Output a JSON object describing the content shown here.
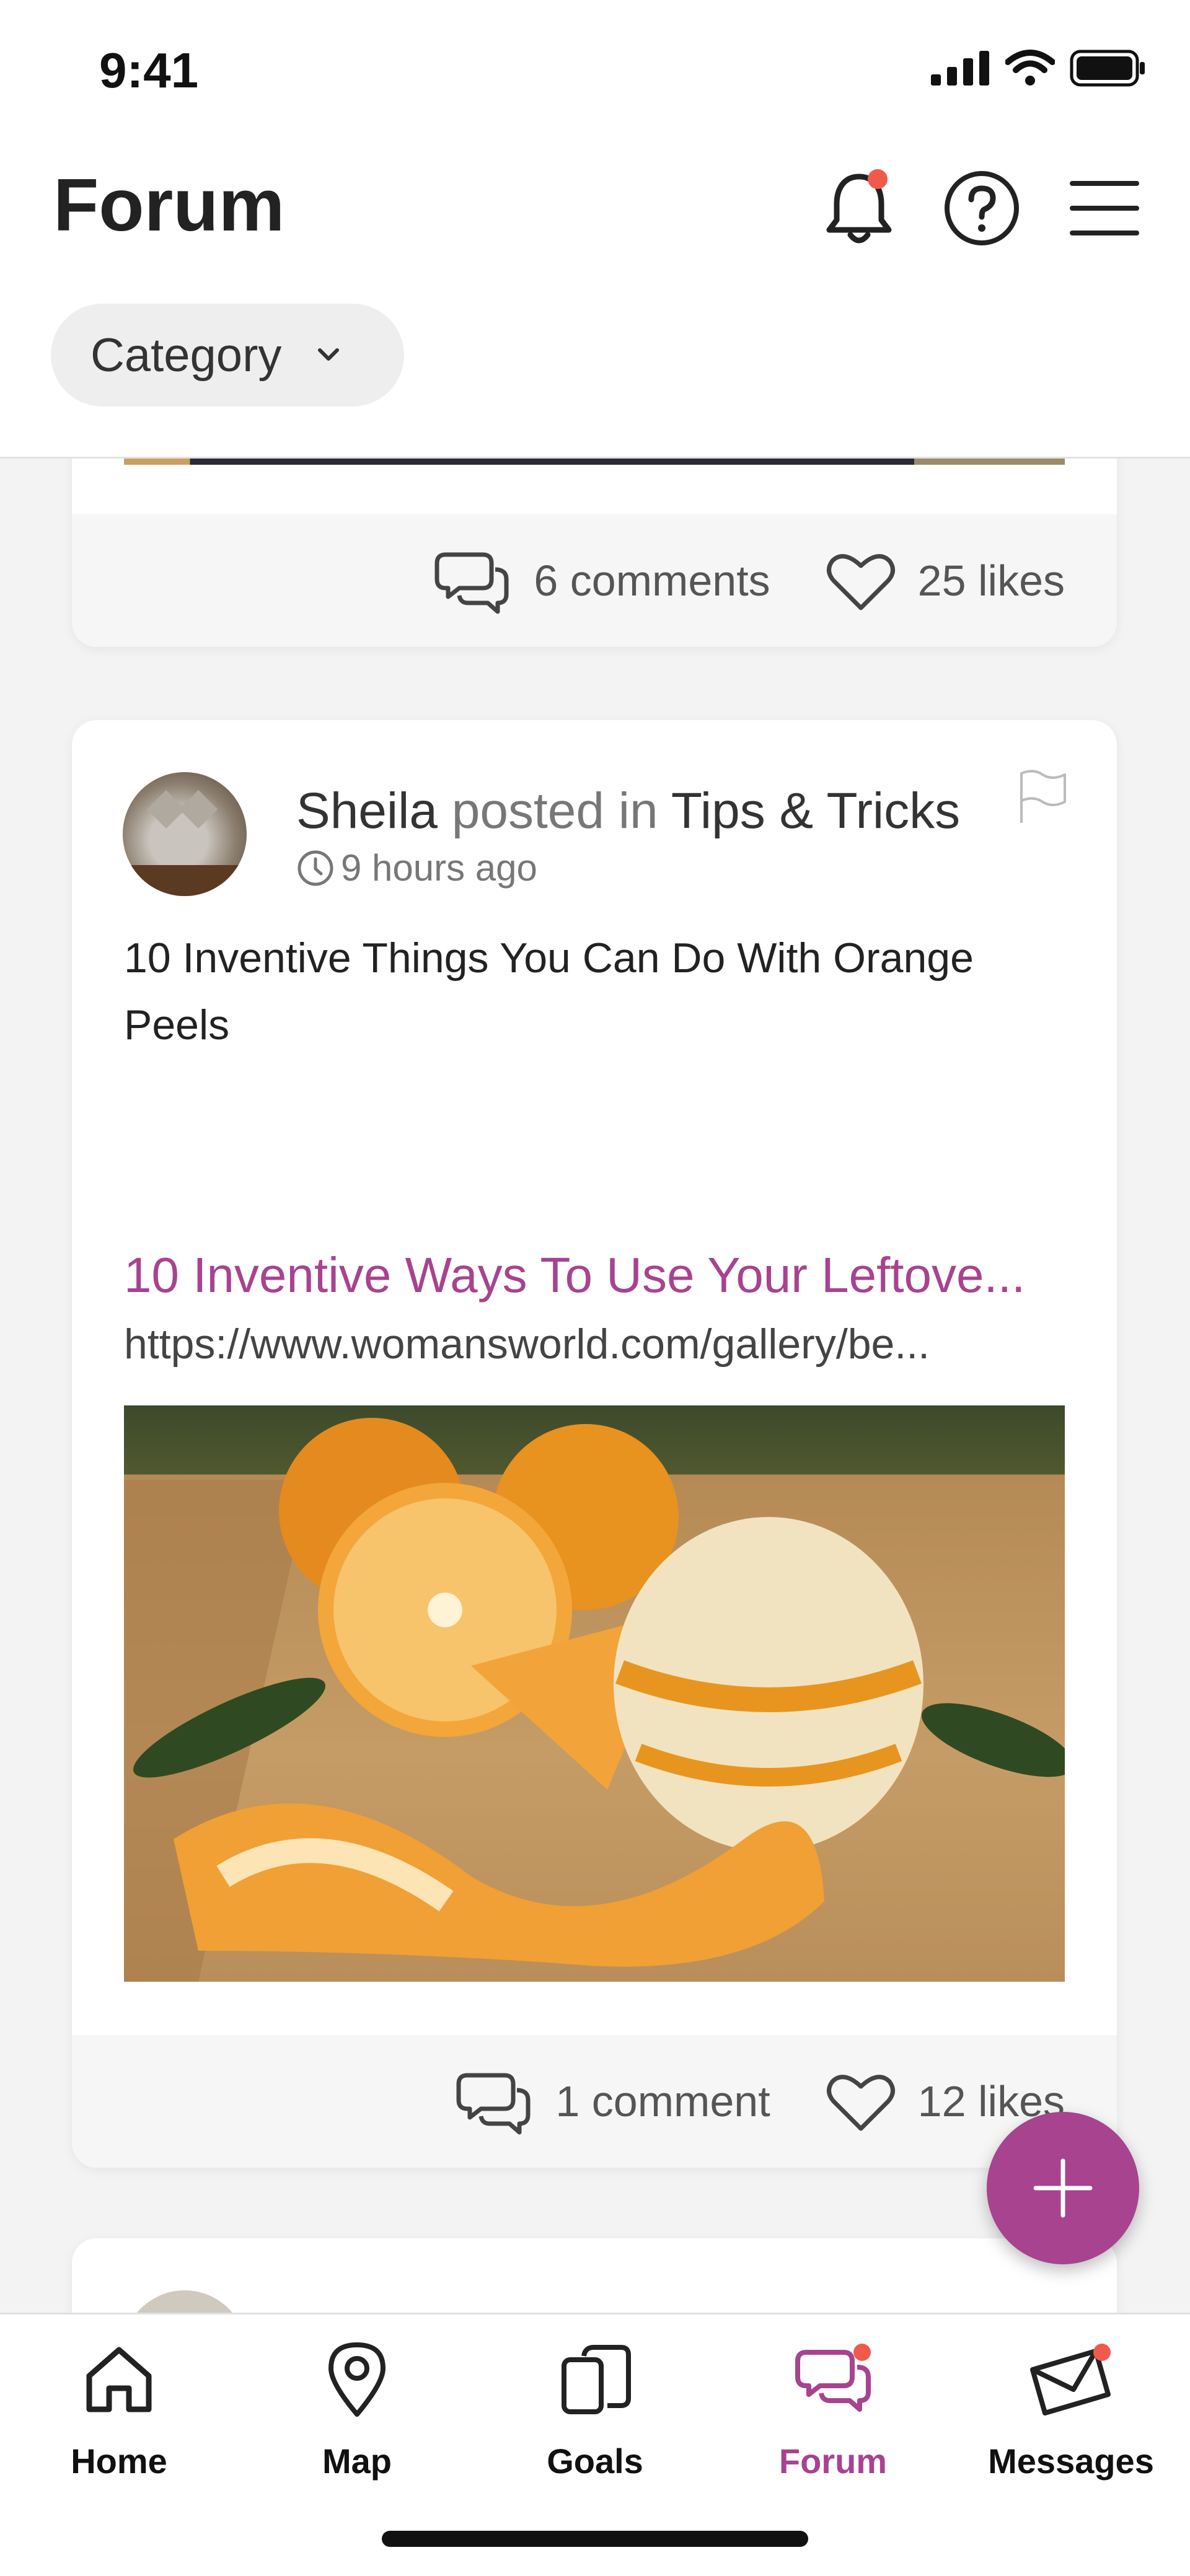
{
  "status_bar": {
    "time": "9:41"
  },
  "header": {
    "title": "Forum",
    "category_label": "Category"
  },
  "top_card": {
    "comments": "6 comments",
    "likes": "25 likes"
  },
  "post": {
    "author": "Sheila",
    "posted_in": "posted in",
    "category": "Tips & Tricks",
    "time": "9 hours ago",
    "text": "10 Inventive Things You Can Do With Orange Peels",
    "link_title": "10 Inventive Ways To Use Your Leftove...",
    "link_url": "https://www.womansworld.com/gallery/be...",
    "comments": "1 comment",
    "likes": "12 likes"
  },
  "tabs": [
    {
      "label": "Home",
      "icon": "home-icon"
    },
    {
      "label": "Map",
      "icon": "map-pin-icon"
    },
    {
      "label": "Goals",
      "icon": "cards-icon"
    },
    {
      "label": "Forum",
      "icon": "chat-bubbles-icon"
    },
    {
      "label": "Messages",
      "icon": "envelope-icon"
    }
  ],
  "colors": {
    "accent": "#a7438f",
    "notification_dot": "#ef5a4c"
  }
}
